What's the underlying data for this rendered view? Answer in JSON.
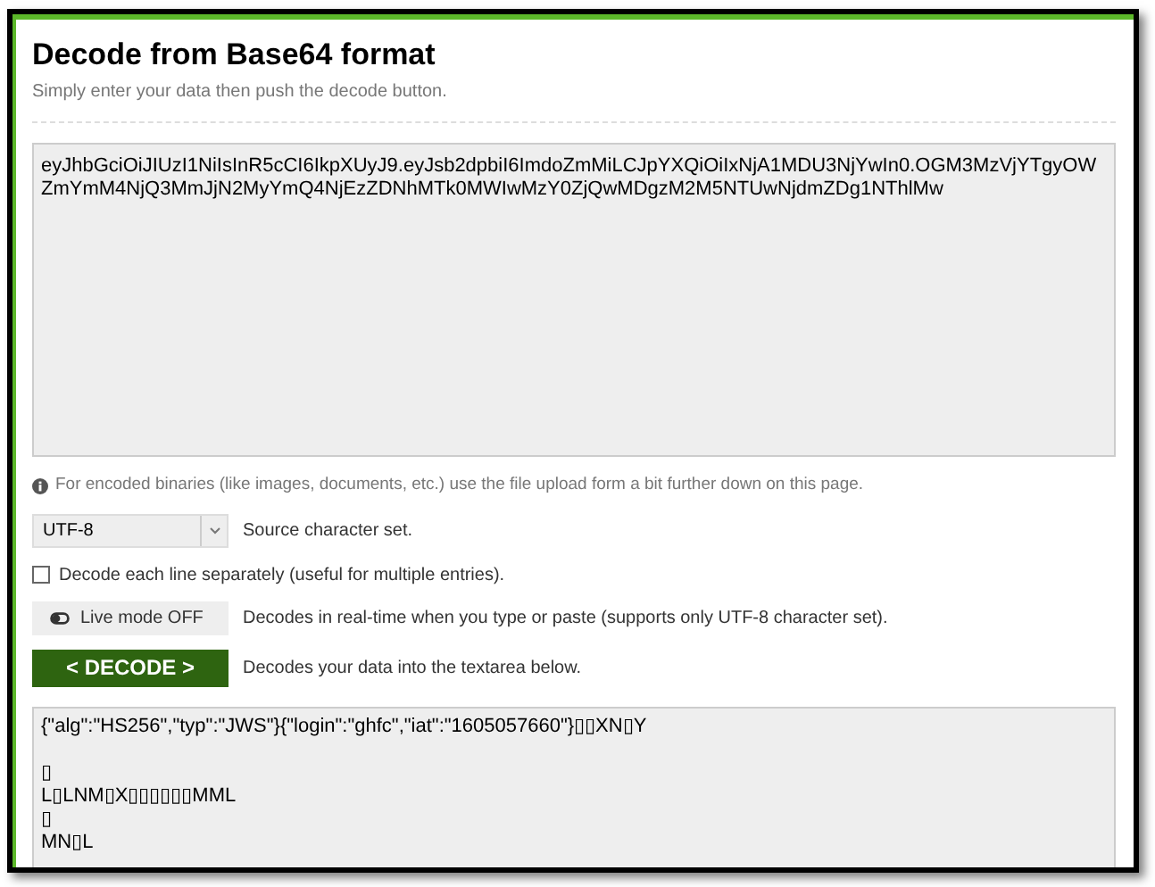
{
  "title": "Decode from Base64 format",
  "subtitle": "Simply enter your data then push the decode button.",
  "input": {
    "value": "eyJhbGciOiJIUzI1NiIsInR5cCI6IkpXUyJ9.eyJsb2dpbiI6ImdoZmMiLCJpYXQiOiIxNjA1MDU3NjYwIn0.OGM3MzVjYTgyOWZmYmM4NjQ3MmJjN2MyYmQ4NjEzZDNhMTk0MWIwMzY0ZjQwMDgzM2M5NTUwNjdmZDg1NThlMw"
  },
  "info": "For encoded binaries (like images, documents, etc.) use the file upload form a bit further down on this page.",
  "charset": {
    "value": "UTF-8",
    "label": "Source character set."
  },
  "each_line": {
    "checked": false,
    "label": "Decode each line separately (useful for multiple entries)."
  },
  "live_mode": {
    "on": false,
    "button": "Live mode OFF",
    "label": "Decodes in real-time when you type or paste (supports only UTF-8 character set)."
  },
  "decode": {
    "button": "< DECODE >",
    "label": "Decodes your data into the textarea below."
  },
  "output": {
    "value": "{\"alg\":\"HS256\",\"typ\":\"JWS\"}{\"login\":\"ghfc\",\"iat\":\"1605057660\"}▯▯XN▯Y\n\n▯\nL▯LNM▯X▯▯▯▯▯▯MML\n▯\nMN▯L"
  }
}
